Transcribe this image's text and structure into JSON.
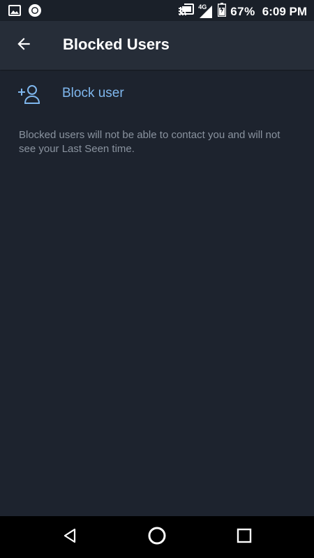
{
  "status_bar": {
    "network_label": "4G",
    "battery_percent": "67%",
    "time": "6:09 PM",
    "icons": [
      "image-icon",
      "record-icon",
      "cast-icon",
      "signal-icon",
      "battery-icon"
    ]
  },
  "app_bar": {
    "title": "Blocked Users",
    "back_icon": "arrow-left-icon"
  },
  "block_user": {
    "label": "Block user",
    "icon": "add-user-icon"
  },
  "info": {
    "text": "Blocked users will not be able to contact you and will not see your Last Seen time."
  },
  "nav_bar": {
    "icons": [
      "nav-back-icon",
      "nav-home-icon",
      "nav-recents-icon"
    ]
  },
  "colors": {
    "background": "#1d232e",
    "app_bar": "#262d38",
    "accent": "#7fb7ee",
    "secondary_text": "#8a939f"
  }
}
